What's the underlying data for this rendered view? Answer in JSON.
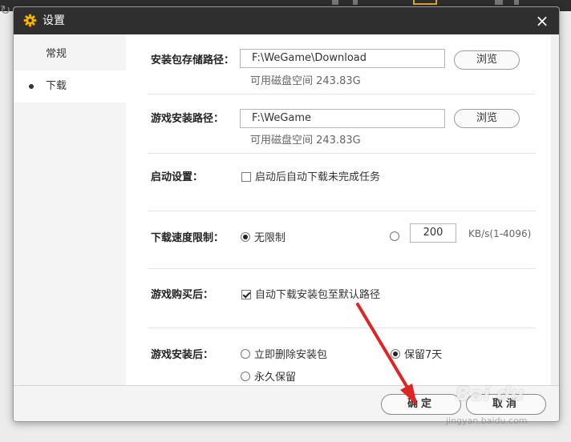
{
  "window": {
    "title": "设置",
    "close_glyph": "×",
    "title_icon": "gear-icon",
    "accent": "#f5b400"
  },
  "sidebar": {
    "items": [
      {
        "label": "常规",
        "active": false
      },
      {
        "label": "下载",
        "active": true
      }
    ]
  },
  "download": {
    "package_path": {
      "label": "安装包存储路径：",
      "value": "F:\\WeGame\\Download",
      "browse": "浏览",
      "free_space": "可用磁盘空间 243.83G"
    },
    "install_path": {
      "label": "游戏安装路径：",
      "value": "F:\\WeGame",
      "browse": "浏览",
      "free_space": "可用磁盘空间 243.83G"
    },
    "startup": {
      "label": "启动设置：",
      "option": "启动后自动下载未完成任务",
      "checked": false
    },
    "speed_limit": {
      "label": "下载速度限制：",
      "unlimited": "无限制",
      "unlimited_selected": true,
      "value": "200",
      "unit": "KB/s(1-4096)"
    },
    "after_purchase": {
      "label": "游戏购买后：",
      "option": "自动下载安装包至默认路径",
      "checked": true
    },
    "after_install": {
      "label": "游戏安装后：",
      "options": [
        {
          "label": "立即删除安装包",
          "selected": false
        },
        {
          "label": "保留7天",
          "selected": true
        },
        {
          "label": "永久保留",
          "selected": false
        }
      ]
    }
  },
  "footer": {
    "ok": "确定",
    "cancel": "取消"
  },
  "watermark": {
    "logo": "Bai du",
    "url": "jingyan.baidu.com"
  },
  "annotation_color": "#e02424"
}
